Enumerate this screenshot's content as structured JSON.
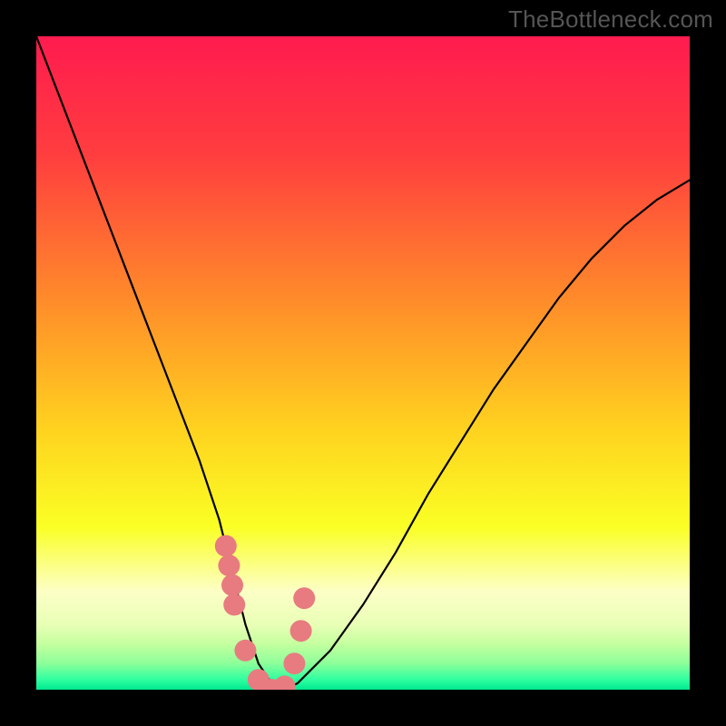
{
  "watermark": "TheBottleneck.com",
  "chart_data": {
    "type": "line",
    "title": "",
    "xlabel": "",
    "ylabel": "",
    "xlim": [
      0,
      100
    ],
    "ylim": [
      0,
      100
    ],
    "grid": false,
    "legend_position": "none",
    "annotations": [],
    "series": [
      {
        "name": "bottleneck-curve",
        "x": [
          0,
          5,
          10,
          15,
          20,
          25,
          28,
          30,
          32,
          34,
          36,
          38,
          40,
          45,
          50,
          55,
          60,
          65,
          70,
          75,
          80,
          85,
          90,
          95,
          100
        ],
        "y": [
          100,
          87,
          74,
          61,
          48,
          35,
          26,
          18,
          10,
          4,
          1,
          0,
          1,
          6,
          13,
          21,
          30,
          38,
          46,
          53,
          60,
          66,
          71,
          75,
          78
        ]
      }
    ],
    "markers": {
      "name": "highlighted-points",
      "color": "#e77b80",
      "x": [
        29.0,
        29.5,
        30.0,
        30.3,
        32.0,
        34.0,
        36.0,
        38.0,
        39.5,
        40.5,
        41.0
      ],
      "y": [
        22,
        19,
        16,
        13,
        6,
        1.5,
        0,
        0.5,
        4,
        9,
        14
      ]
    },
    "background_gradient": {
      "stops": [
        {
          "pos": 0.0,
          "color": "#ff1b4f"
        },
        {
          "pos": 0.18,
          "color": "#ff3d3f"
        },
        {
          "pos": 0.4,
          "color": "#ff8a2a"
        },
        {
          "pos": 0.6,
          "color": "#ffd21f"
        },
        {
          "pos": 0.75,
          "color": "#faff24"
        },
        {
          "pos": 0.85,
          "color": "#fcffc6"
        },
        {
          "pos": 0.9,
          "color": "#e9ffb6"
        },
        {
          "pos": 0.93,
          "color": "#c4ff9f"
        },
        {
          "pos": 0.96,
          "color": "#8cff9a"
        },
        {
          "pos": 0.985,
          "color": "#2dffa0"
        },
        {
          "pos": 1.0,
          "color": "#00e88f"
        }
      ]
    }
  }
}
